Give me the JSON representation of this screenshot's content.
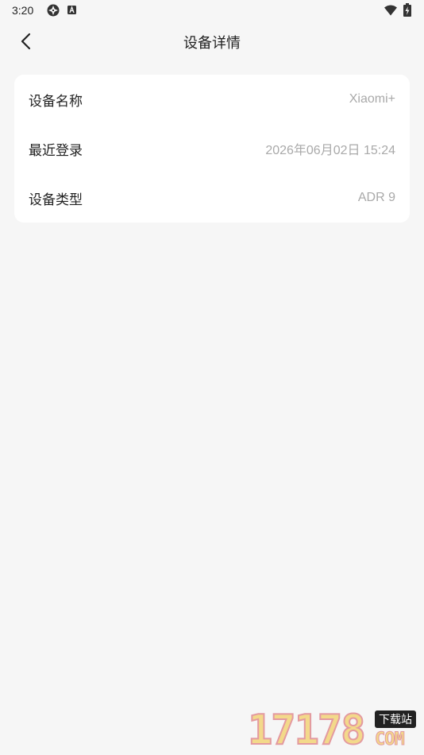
{
  "status_bar": {
    "time": "3:20"
  },
  "header": {
    "title": "设备详情",
    "back_icon": "chevron-left-icon"
  },
  "details": [
    {
      "label": "设备名称",
      "value": "Xiaomi+"
    },
    {
      "label": "最近登录",
      "value": "2026年06月02日 15:24"
    },
    {
      "label": "设备类型",
      "value": "ADR 9"
    }
  ],
  "watermark": {
    "number": "17178",
    "badge": "下载站",
    "domain": "COM"
  }
}
